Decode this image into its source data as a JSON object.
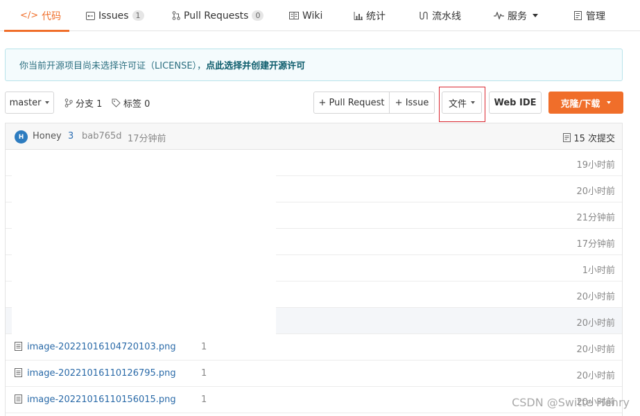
{
  "nav": {
    "tabs": [
      {
        "label": "代码",
        "icon": "code-icon",
        "active": true
      },
      {
        "label": "Issues",
        "badge": "1",
        "icon": "issues-icon"
      },
      {
        "label": "Pull Requests",
        "badge": "0",
        "icon": "pull-request-icon"
      },
      {
        "label": "Wiki",
        "icon": "book-icon"
      },
      {
        "label": "统计",
        "icon": "stats-icon"
      },
      {
        "label": "流水线",
        "icon": "pipeline-icon"
      },
      {
        "label": "服务",
        "icon": "pulse-icon"
      },
      {
        "label": "管理",
        "icon": "manage-icon"
      }
    ],
    "accent": "#f06e2a"
  },
  "notice": {
    "text": "你当前开源项目尚未选择许可证（LICENSE），",
    "link": "点此选择并创建开源许可"
  },
  "toolbar": {
    "branch": "master",
    "branches_label": "分支 1",
    "tags_label": "标签 0",
    "pull_request_label": "+ Pull Request",
    "issue_label": "+ Issue",
    "file_label": "文件",
    "webide_label": "Web IDE",
    "clone_label": "克隆/下载"
  },
  "commit": {
    "avatar_letter": "H",
    "author": "Honey",
    "count": "3",
    "sha": "bab765d",
    "time": "17分钟前",
    "total": "15 次提交"
  },
  "rows": [
    {
      "time": "19小时前"
    },
    {
      "time": "20小时前"
    },
    {
      "time": "21分钟前"
    },
    {
      "time": "17分钟前"
    },
    {
      "time": "1小时前"
    },
    {
      "time": "20小时前"
    },
    {
      "time": "20小时前"
    },
    {
      "name": "image-20221016104720103.png",
      "num": "1",
      "time": "20小时前"
    },
    {
      "name": "image-20221016110126795.png",
      "num": "1",
      "time": "20小时前"
    },
    {
      "name": "image-20221016110156015.png",
      "num": "1",
      "time": "20小时前"
    }
  ],
  "watermark": "CSDN @Switte  Henry"
}
